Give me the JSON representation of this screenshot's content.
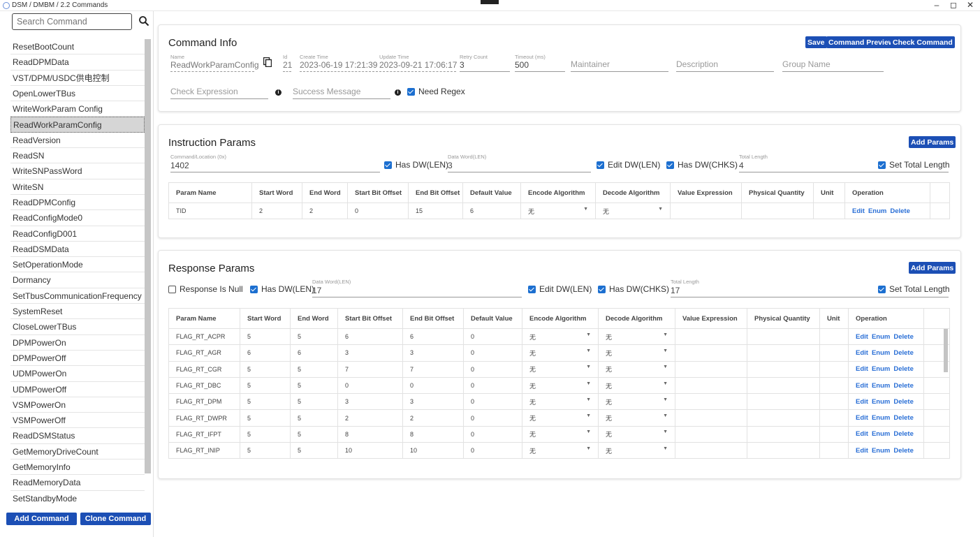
{
  "window": {
    "title": "DSM / DMBM / 2.2 Commands",
    "minimize": "–",
    "maximize": "◻",
    "close": "✕"
  },
  "sidebar": {
    "search_placeholder": "Search Command",
    "commands": [
      "ResetBootCount",
      "ReadDPMData",
      "VST/DPM/USDC供电控制",
      "OpenLowerTBus",
      "WriteWorkParam Config",
      "ReadWorkParamConfig",
      "ReadVersion",
      "ReadSN",
      "WriteSNPassWord",
      "WriteSN",
      "ReadDPMConfig",
      "ReadConfigMode0",
      "ReadConfigD001",
      "ReadDSMData",
      "SetOperationMode",
      "Dormancy",
      "SetTbusCommunicationFrequency",
      "SystemReset",
      "CloseLowerTBus",
      "DPMPowerOn",
      "DPMPowerOff",
      "UDMPowerOn",
      "UDMPowerOff",
      "VSMPowerOn",
      "VSMPowerOff",
      "ReadDSMStatus",
      "GetMemoryDriveCount",
      "GetMemoryInfo",
      "ReadMemoryData",
      "SetStandbyMode",
      "—"
    ],
    "selected_index": 5,
    "add_command": "Add Command",
    "clone_command": "Clone Command"
  },
  "command_info": {
    "title": "Command Info",
    "buttons": {
      "save": "Save",
      "preview": "Command Preview",
      "check": "Check Command"
    },
    "name_label": "Name",
    "name_value": "ReadWorkParamConfig",
    "id_label": "Id",
    "id_value": "21",
    "create_label": "Create Time",
    "create_value": "2023-06-19 17:21:39",
    "update_label": "Update Time",
    "update_value": "2023-09-21 17:06:17",
    "retry_label": "Retry Count",
    "retry_value": "3",
    "timeout_label": "Timeout (ms)",
    "timeout_value": "500",
    "maintainer_ph": "Maintainer",
    "description_ph": "Description",
    "group_ph": "Group Name",
    "check_expr_ph": "Check Expression",
    "success_msg_ph": "Success Message",
    "need_regex": "Need Regex",
    "info_glyph": "i"
  },
  "instruction": {
    "title": "Instruction Params",
    "add_params": "Add Params",
    "cmd_loc_label": "Command/Location (0x)",
    "cmd_loc_value": "1402",
    "has_dw_len": "Has DW(LEN)",
    "data_word_label": "Data Word(LEN)",
    "data_word_value": "3",
    "edit_dw_len": "Edit DW(LEN)",
    "has_dw_chks": "Has DW(CHKS)",
    "total_len_label": "Total Length",
    "total_len_value": "4",
    "set_total_length": "Set Total Length",
    "headers": [
      "Param Name",
      "Start Word",
      "End Word",
      "Start Bit Offset",
      "End Bit Offset",
      "Default Value",
      "Encode Algorithm",
      "Decode Algorithm",
      "Value Expression",
      "Physical Quantity",
      "Unit",
      "Operation"
    ],
    "rows": [
      {
        "name": "TID",
        "sw": "2",
        "ew": "2",
        "sbo": "0",
        "ebo": "15",
        "dv": "6",
        "enc": "无",
        "dec": "无",
        "expr": "",
        "pq": "",
        "unit": ""
      }
    ]
  },
  "response": {
    "title": "Response Params",
    "add_params": "Add Params",
    "is_null": "Response Is Null",
    "has_dw_len": "Has DW(LEN)",
    "data_word_label": "Data Word(LEN)",
    "data_word_value": "17",
    "edit_dw_len": "Edit DW(LEN)",
    "has_dw_chks": "Has DW(CHKS)",
    "total_len_label": "Total Length",
    "total_len_value": "17",
    "set_total_length": "Set Total Length",
    "headers": [
      "Param Name",
      "Start Word",
      "End Word",
      "Start Bit Offset",
      "End Bit Offset",
      "Default Value",
      "Encode Algorithm",
      "Decode Algorithm",
      "Value Expression",
      "Physical Quantity",
      "Unit",
      "Operation"
    ],
    "rows": [
      {
        "name": "FLAG_RT_ACPR",
        "sw": "5",
        "ew": "5",
        "sbo": "6",
        "ebo": "6",
        "dv": "0",
        "enc": "无",
        "dec": "无"
      },
      {
        "name": "FLAG_RT_AGR",
        "sw": "6",
        "ew": "6",
        "sbo": "3",
        "ebo": "3",
        "dv": "0",
        "enc": "无",
        "dec": "无"
      },
      {
        "name": "FLAG_RT_CGR",
        "sw": "5",
        "ew": "5",
        "sbo": "7",
        "ebo": "7",
        "dv": "0",
        "enc": "无",
        "dec": "无"
      },
      {
        "name": "FLAG_RT_DBC",
        "sw": "5",
        "ew": "5",
        "sbo": "0",
        "ebo": "0",
        "dv": "0",
        "enc": "无",
        "dec": "无"
      },
      {
        "name": "FLAG_RT_DPM",
        "sw": "5",
        "ew": "5",
        "sbo": "3",
        "ebo": "3",
        "dv": "0",
        "enc": "无",
        "dec": "无"
      },
      {
        "name": "FLAG_RT_DWPR",
        "sw": "5",
        "ew": "5",
        "sbo": "2",
        "ebo": "2",
        "dv": "0",
        "enc": "无",
        "dec": "无"
      },
      {
        "name": "FLAG_RT_IFPT",
        "sw": "5",
        "ew": "5",
        "sbo": "8",
        "ebo": "8",
        "dv": "0",
        "enc": "无",
        "dec": "无"
      },
      {
        "name": "FLAG_RT_INIP",
        "sw": "5",
        "ew": "5",
        "sbo": "10",
        "ebo": "10",
        "dv": "0",
        "enc": "无",
        "dec": "无"
      }
    ]
  },
  "operations": {
    "edit": "Edit",
    "enum": "Enum",
    "delete": "Delete"
  },
  "colors": {
    "accent": "#1c4fb5",
    "checkbox": "#1c6fd0",
    "link": "#2a6fd6"
  }
}
